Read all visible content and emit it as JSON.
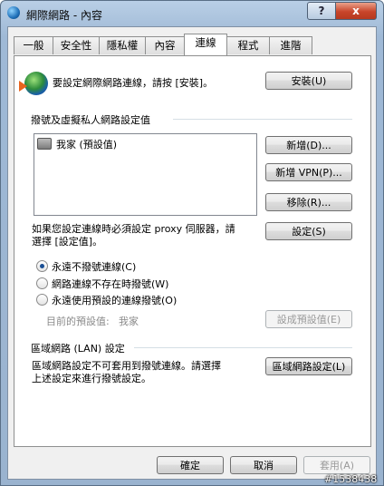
{
  "window": {
    "title": "網際網路 - 內容",
    "help_label": "?",
    "close_label": "x"
  },
  "tabs": [
    {
      "label": "一般"
    },
    {
      "label": "安全性"
    },
    {
      "label": "隱私權"
    },
    {
      "label": "內容"
    },
    {
      "label": "連線"
    },
    {
      "label": "程式"
    },
    {
      "label": "進階"
    }
  ],
  "active_tab": "連線",
  "setup": {
    "text": "要設定網際網路連線，請按 [安裝]。",
    "button": "安裝(U)"
  },
  "dialup": {
    "section_title": "撥號及虛擬私人網路設定值",
    "connections": [
      {
        "label": "我家 (預設值)"
      }
    ],
    "add_button": "新增(D)...",
    "add_vpn_button": "新增 VPN(P)...",
    "remove_button": "移除(R)...",
    "proxy_text_line1": "如果您設定連線時必須設定 proxy 伺服器，請",
    "proxy_text_line2": "選擇 [設定值]。",
    "settings_button": "設定(S)",
    "options": [
      {
        "label": "永遠不撥號連線(C)",
        "selected": true
      },
      {
        "label": "網路連線不存在時撥號(W)",
        "selected": false
      },
      {
        "label": "永遠使用預設的連線撥號(O)",
        "selected": false
      }
    ],
    "current_default_label": "目前的預設值:",
    "current_default_value": "我家",
    "set_default_button": "設成預設值(E)"
  },
  "lan": {
    "section_title": "區域網路 (LAN) 設定",
    "text_line1": "區域網路設定不可套用到撥號連線。請選擇",
    "text_line2": "上述設定來進行撥號設定。",
    "button": "區域網路設定(L)"
  },
  "footer": {
    "ok": "確定",
    "cancel": "取消",
    "apply": "套用(A)"
  },
  "watermark": "#1538438"
}
